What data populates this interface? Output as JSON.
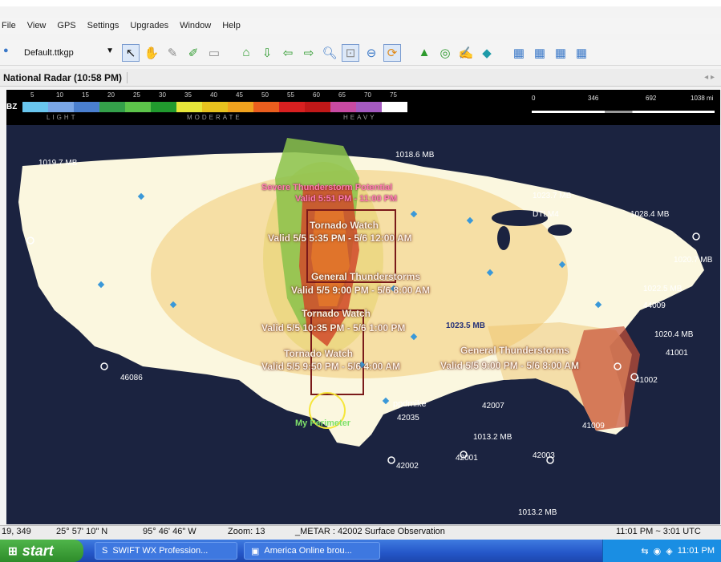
{
  "menu": [
    "File",
    "View",
    "GPS",
    "Settings",
    "Upgrades",
    "Window",
    "Help"
  ],
  "toolbar": {
    "profile": "Default.ttkgp"
  },
  "tab": {
    "title": "National Radar (10:58 PM)"
  },
  "legend": {
    "label": "BZ",
    "values": [
      "5",
      "10",
      "15",
      "20",
      "25",
      "30",
      "35",
      "40",
      "45",
      "50",
      "55",
      "60",
      "65",
      "70",
      "75"
    ],
    "colors": [
      "#69c6ee",
      "#7aa6e6",
      "#4a7fcf",
      "#34a04a",
      "#5cc44a",
      "#219a2e",
      "#e6e63a",
      "#e8c21e",
      "#f0a21e",
      "#ea5e1e",
      "#d82020",
      "#c01818",
      "#c84aa2",
      "#a45ac0",
      "#ffffff"
    ],
    "sub_light": "LIGHT",
    "sub_moderate": "MODERATE",
    "sub_heavy": "HEAVY",
    "distance": [
      "0",
      "346",
      "692",
      "1038 mi"
    ]
  },
  "map": {
    "events": {
      "severe": "Severe Thunderstorm Potential",
      "severe_valid": "Valid 5:51 PM - 11:00 PM",
      "tornado1": "Tornado Watch",
      "tornado1_valid": "Valid 5/5 5:35 PM - 5/6 12:00 AM",
      "general1": "General Thunderstorms",
      "general1_valid": "Valid 5/5 9:00 PM - 5/6 8:00 AM",
      "tornado2": "Tornado Watch",
      "tornado2_valid": "Valid 5/5 10:35 PM - 5/6 1:00 PM",
      "tornado3": "Tornado Watch",
      "tornado3_valid": "Valid 5/5 9:50 PM - 5/6 4:00 AM",
      "general2": "General Thunderstorms",
      "general2_valid": "Valid 5/5 9:00 PM - 5/6 8:00 AM"
    },
    "pressure": [
      "1019.7 MB",
      "1018.6 MB",
      "1023.7 MB",
      "1028.4 MB",
      "1020.7 MB",
      "1022.5 MB",
      "1020.4 MB",
      "1013.2 MB",
      "1013.2 MB",
      "1023.5 MB"
    ],
    "stations": [
      "DTLM4",
      "44009",
      "41001",
      "41002",
      "42007",
      "42035",
      "41009",
      "42001",
      "42002",
      "42003",
      "46086"
    ],
    "places": [
      "My Perimeter",
      "ppdmike"
    ]
  },
  "status": {
    "coord_xy": "19, 349",
    "lat": "25° 57' 10\" N",
    "lon": "95° 46' 46\" W",
    "zoom": "Zoom: 13",
    "metar": "_METAR : 42002 Surface Observation",
    "time": "11:01 PM ~ 3:01 UTC"
  },
  "taskbar": {
    "start": "start",
    "task1": "SWIFT WX Profession...",
    "task2": "America Online brou...",
    "clock": "11:01 PM"
  }
}
